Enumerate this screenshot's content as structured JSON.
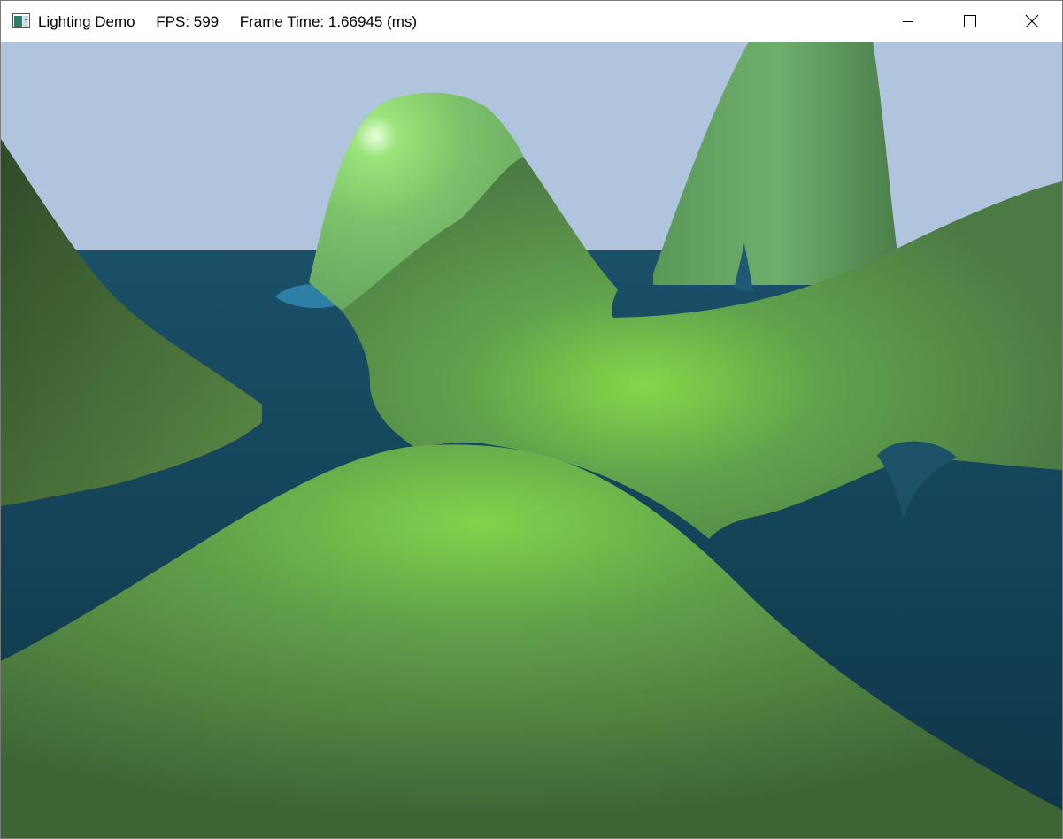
{
  "window": {
    "app_name": "Lighting Demo",
    "fps_text": "FPS: 599",
    "frame_time_text": "Frame Time: 1.66945 (ms)",
    "icons": {
      "app": "app-window-icon",
      "minimize": "minimize-icon",
      "maximize": "maximize-icon",
      "close": "close-icon"
    }
  },
  "scene": {
    "description_colors": {
      "sky": "#b0c4de",
      "water": "#123f55",
      "terrain": "#5a8a48",
      "terrain_highlight": "#84d84a"
    }
  }
}
